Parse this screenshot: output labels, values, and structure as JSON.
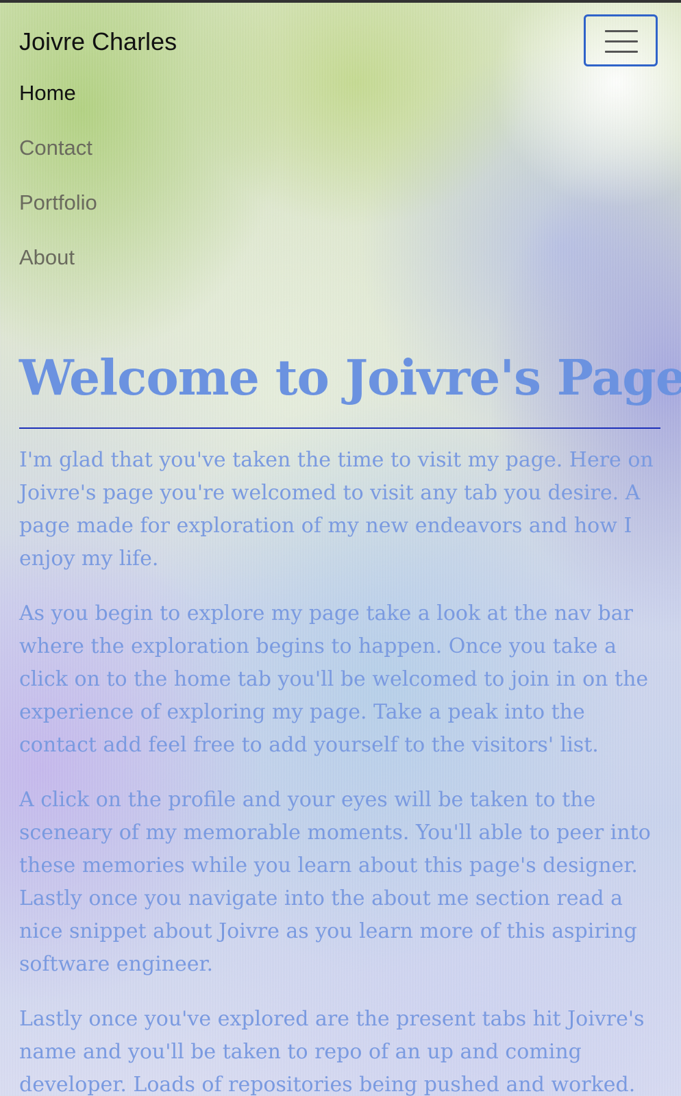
{
  "navbar": {
    "brand": "Joivre Charles",
    "toggler_icon": "hamburger-menu-icon",
    "items": [
      {
        "label": "Home",
        "active": true
      },
      {
        "label": "Contact",
        "active": false
      },
      {
        "label": "Portfolio",
        "active": false
      },
      {
        "label": "About",
        "active": false
      }
    ]
  },
  "main": {
    "title": "Welcome to Joivre's Page",
    "paragraphs": [
      "I'm glad that you've taken the time to visit my page. Here on Joivre's page you're welcomed to visit any tab you desire. A page made for exploration of my new endeavors and how I enjoy my life.",
      "As you begin to explore my page take a look at the nav bar where the exploration begins to happen. Once you take a click on to the home tab you'll be welcomed to join in on the experience of exploring my page. Take a peak into the contact add feel free to add yourself to the visitors' list.",
      "A click on the profile and your eyes will be taken to the sceneary of my memorable moments. You'll able to peer into these memories while you learn about this page's designer. Lastly once you navigate into the about me section read a nice snippet about Joivre as you learn more of this aspiring software engineer.",
      "Lastly once you've explored are the present tabs hit Joivre's name and you'll be taken to repo of an up and coming developer. Loads of repositories being pushed and worked. Enjoy the tour and thanks for visiting Joivre's site."
    ]
  },
  "colors": {
    "title": "#6b92e0",
    "body_text": "#7a9ae0",
    "rule": "#1c2fb8",
    "toggler_border": "#2f63c9"
  }
}
